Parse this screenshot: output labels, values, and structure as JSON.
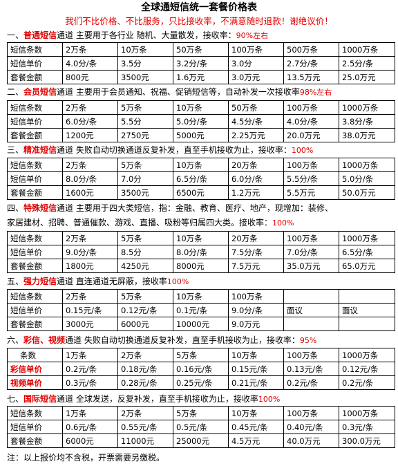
{
  "title": "全球通短信统一套餐价格表",
  "subtitle": "我们不比价格、不比服务，只比接收率，不满意随时退款！谢绝议价！",
  "sections": [
    {
      "num": "一、",
      "name": "普通短信",
      "desc": "通道  主要用于各行业 随机、大量散发，接收率：",
      "rate": "90%左右",
      "rows": [
        [
          "短信条数",
          "2万条",
          "10万条",
          "50万条",
          "100万条",
          "500万条",
          "1000万条"
        ],
        [
          "短信单价",
          "4.0分/条",
          "3.5分",
          "3.2分/条",
          "3.0分",
          "2.7分/条",
          "2.5分/条"
        ],
        [
          "套餐金额",
          "800元",
          "3500元",
          "1.6万元",
          "3.0万元",
          "13.5万元",
          "25.0万元"
        ]
      ]
    },
    {
      "num": "二、",
      "name": "会员短信",
      "desc": "通道 主要用于会员通知、祝福、促销短信等，自动补发一次接收率",
      "rate": "98%左右",
      "rows": [
        [
          "短信条数",
          "2万条",
          "5万条",
          "10万条",
          "50万条",
          "100万条",
          "1000万条"
        ],
        [
          "短信单价",
          "6.0分/条",
          "5.5分",
          "5.0分/条",
          "4.5分/条",
          "4.0分/条",
          "3.8分/条"
        ],
        [
          "套餐金额",
          "1200元",
          "2750元",
          "5000元",
          "2.25万元",
          "20.0万元",
          "38.0万元"
        ]
      ]
    },
    {
      "num": "三、",
      "name": "精准短信",
      "desc": "通道   失败自动切换通道反复补发，直至手机接收为止，接收率：",
      "rate": "100%",
      "rows": [
        [
          "短信条数",
          "2万条",
          "5万条",
          "10万条",
          "20万条",
          "100万条",
          "1000万条"
        ],
        [
          "短信单价",
          "8.0分/条",
          "7.0分",
          "6.5分/条",
          "6.0分/条",
          "5.5分/条",
          "5.0分/条"
        ],
        [
          "套餐金额",
          "1600元",
          "3500元",
          "6500元",
          "1.2万元",
          "5.5万元",
          "50.0万元"
        ]
      ]
    },
    {
      "num": "四、",
      "name": "特殊短信",
      "desc": "通道 主要用于四大类短信，指：金融、教育、医疗、地产，现增加：装修、",
      "desc2": "家居建材、招聘、普通催款、游戏、直播、吸粉等归属四大类。接收率：",
      "rate": "100%",
      "rows": [
        [
          "短信条数",
          "2万条",
          "5万条",
          "10万条",
          "20万条",
          "100万条",
          "1000万条"
        ],
        [
          "短信单价",
          "9.0分/条",
          "8.5分",
          "8.0分/条",
          "7.5分/条",
          "7.0分/条",
          "6.5分/条"
        ],
        [
          "套餐金额",
          "1800元",
          "4250元",
          "8000元",
          "7.5万元",
          "35.0万元",
          "65.0万元"
        ]
      ]
    },
    {
      "num": "五、",
      "name": "强力短信",
      "desc": "通道   直连通道无屏蔽，接收率",
      "rate": "100%",
      "rows": [
        [
          "短信条数",
          "2万条",
          "5万条",
          "10万条",
          "100万条",
          "",
          ""
        ],
        [
          "短信单价",
          "0.15元/条",
          "0.12元/条",
          "0.1元/条",
          "9.0分/条",
          "面议",
          "面议"
        ],
        [
          "套餐金额",
          "3000元",
          "6000元",
          "10000元",
          "9.0万元",
          "",
          ""
        ]
      ]
    },
    {
      "num": "六、",
      "name": "彩信、视频",
      "desc": "通道   失败自动切换通道反复补发，直至手机接收为止，接收率：",
      "rate": "95%",
      "rows": [
        [
          "条数",
          "1万条",
          "2万条",
          "5万条",
          "10万条",
          "100万条",
          "1000万条"
        ],
        [
          "彩信单价",
          "0.2元/条",
          "0.18元/条",
          "0.16元/条",
          "0.15元/条",
          "0.13元/条",
          "0.12元/条"
        ],
        [
          "视频单价",
          "0.3元/条",
          "0.28元/条",
          "0.25元/条",
          "0.21元/条",
          "0.2元/条",
          "0.2元/条"
        ]
      ]
    },
    {
      "num": "七、",
      "name": "国际短信",
      "desc": "通道  全球发送，反复补发，直至手机接收为止，接收率",
      "rate": "100%",
      "rows": [
        [
          "短信条数",
          "1万条",
          "2万条",
          "5万条",
          "10万条",
          "100万条",
          "1000万条"
        ],
        [
          "短信单价",
          "0.6元/条",
          "0.55元/条",
          "0.5元/条",
          "0.45元/条",
          "0.40元/条",
          "0.3元/条"
        ],
        [
          "套餐金额",
          "6000元",
          "11000元",
          "25000元",
          "4.5万元",
          "40.0万元",
          "300.0万元"
        ]
      ]
    }
  ],
  "note": "注：以上报价均不含税，开票需要另缴税。"
}
